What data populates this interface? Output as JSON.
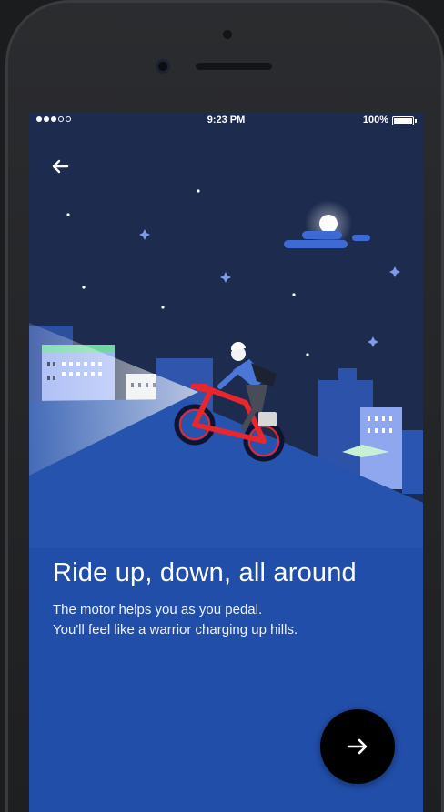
{
  "status_bar": {
    "time": "9:23 PM",
    "battery_percent": "100%",
    "signal_bars_filled": 3,
    "signal_bars_total": 5
  },
  "navigation": {
    "back_icon": "arrow-left-icon",
    "next_icon": "arrow-right-icon"
  },
  "onboarding": {
    "headline": "Ride up, down, all around",
    "body_line_1": "The motor helps you as you pedal.",
    "body_line_2": "You'll feel like a warrior charging up hills."
  },
  "colors": {
    "sky": "#1d2b4e",
    "hill": "#2a57b4",
    "bike": "#e8262d",
    "next_button": "#000000"
  }
}
